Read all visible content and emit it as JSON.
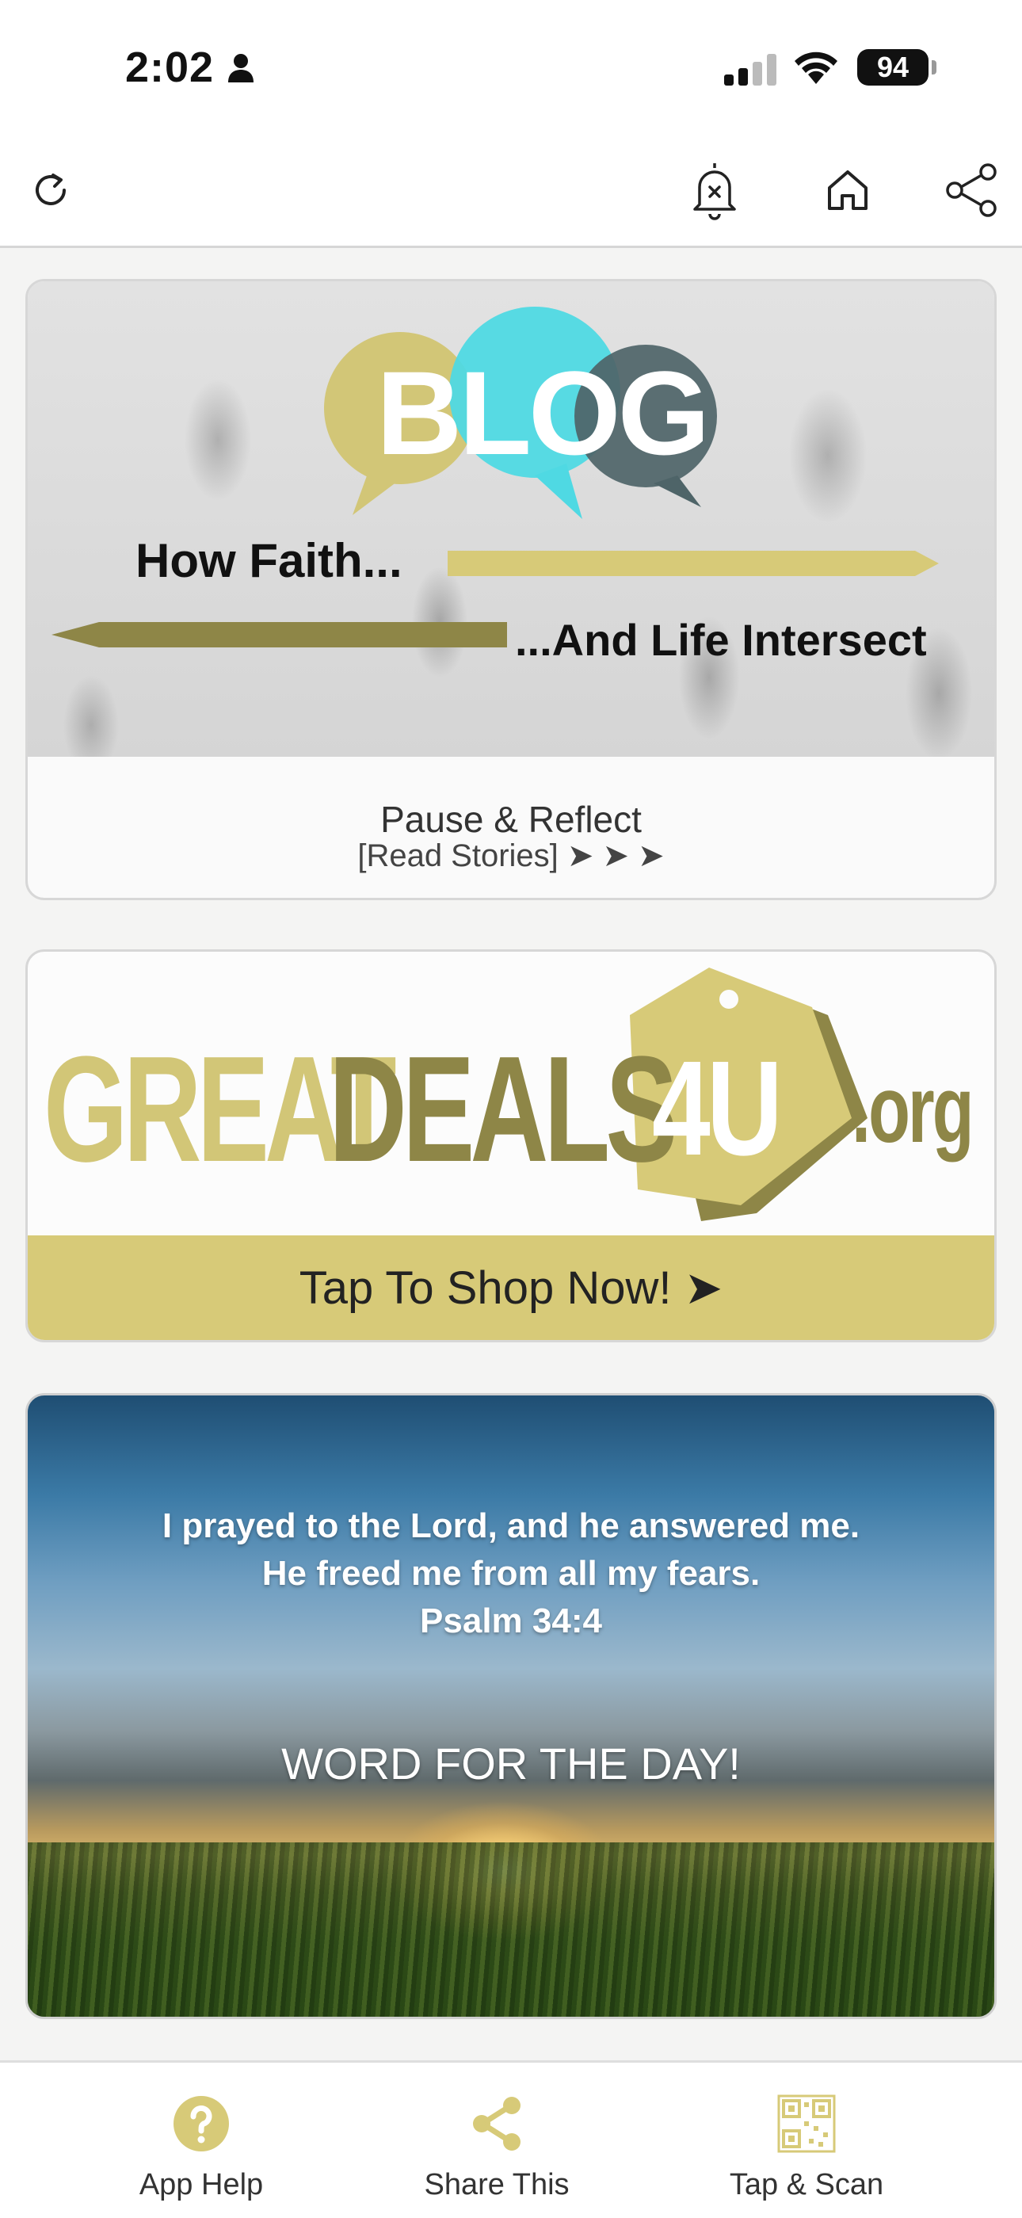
{
  "status_bar": {
    "time": "2:02",
    "battery": "94"
  },
  "toolbar": {
    "icons": [
      "refresh-icon",
      "bell-off-icon",
      "home-icon",
      "share-icon"
    ]
  },
  "blog": {
    "banner": {
      "logo_text": "BLOG",
      "line1": "How Faith...",
      "line2": "...And Life Intersect"
    },
    "title": "Pause & Reflect",
    "subtitle": "[Read Stories] ➤ ➤ ➤"
  },
  "deals": {
    "logo": {
      "part1": "GREAT",
      "part2": "DEALS",
      "tag": "4U",
      "suffix": ".org"
    },
    "button_label": "Tap To Shop Now! ➤"
  },
  "verse": {
    "line1": "I prayed to the Lord, and he answered me.",
    "line2": "He freed me from all my fears.",
    "reference": "Psalm 34:4",
    "heading": "WORD FOR THE DAY!"
  },
  "bottom_nav": {
    "items": [
      {
        "label": "App Help",
        "icon": "question-icon"
      },
      {
        "label": "Share This",
        "icon": "share-icon"
      },
      {
        "label": "Tap & Scan",
        "icon": "qr-code-icon"
      }
    ]
  },
  "colors": {
    "accent_gold": "#d7ca78",
    "dark_gold": "#8e8647",
    "cyan": "#4fd9e3",
    "slate": "#4e6468"
  }
}
